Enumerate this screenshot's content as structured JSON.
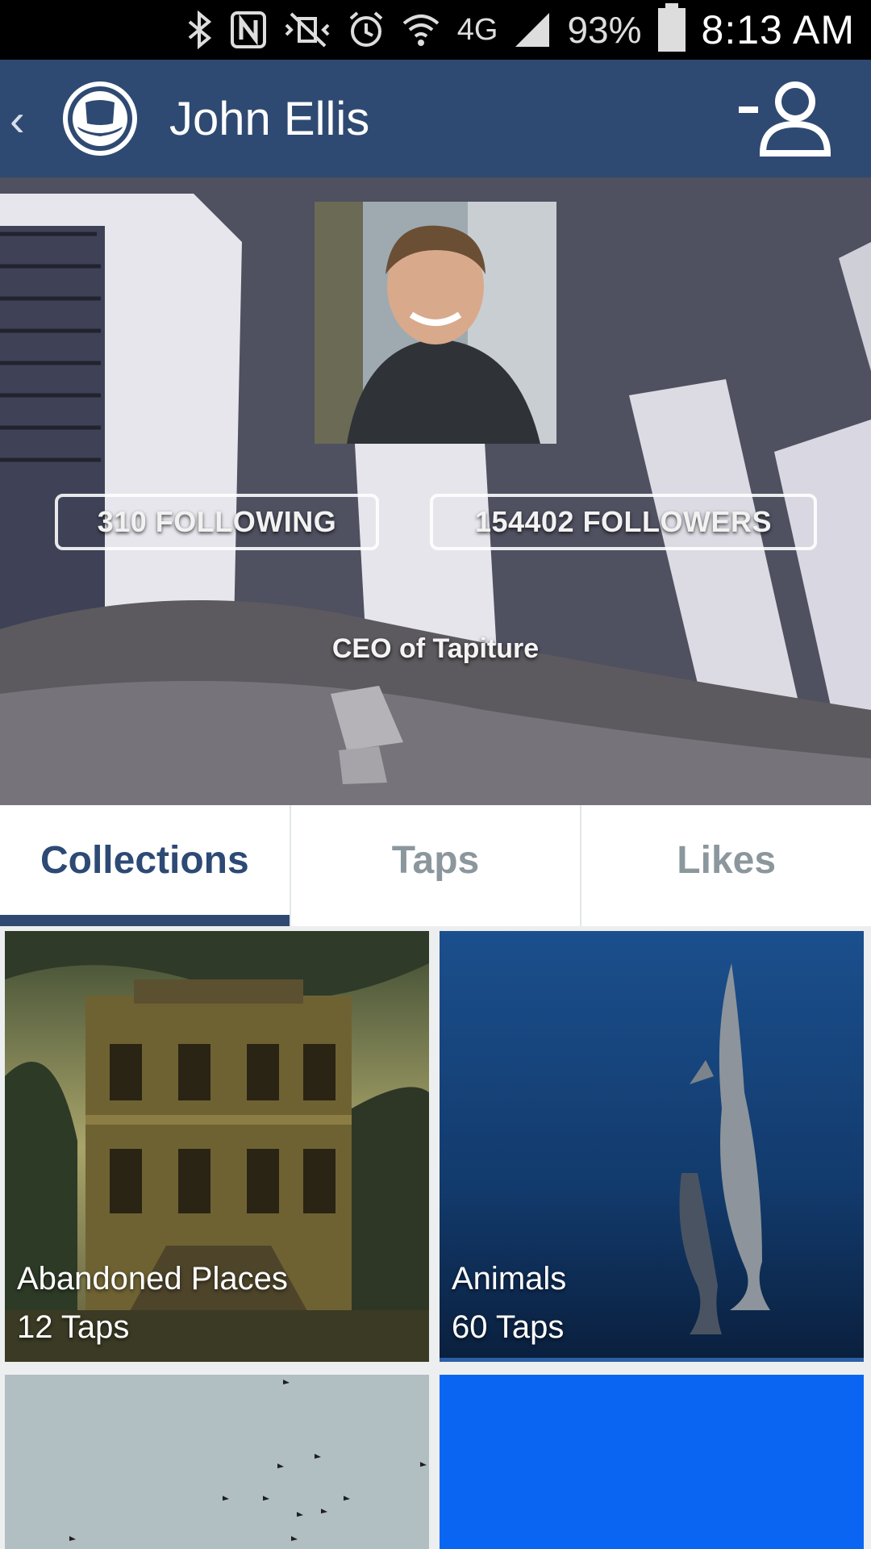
{
  "status_bar": {
    "time": "8:13 AM",
    "battery_percent": "93%",
    "network": "4G",
    "icons": [
      "bluetooth-icon",
      "nfc-icon",
      "vibrate-icon",
      "alarm-icon",
      "wifi-icon",
      "signal-icon",
      "battery-icon"
    ]
  },
  "app_bar": {
    "title": "John Ellis",
    "back_icon": "chevron-left-icon",
    "logo_icon": "top-hat-icon",
    "action_icon": "unfollow-user-icon",
    "color": "#2f4a72"
  },
  "profile": {
    "following_label": "310 FOLLOWING",
    "followers_label": "154402 FOLLOWERS",
    "tagline": "CEO of Tapiture"
  },
  "tabs": [
    {
      "label": "Collections",
      "active": true
    },
    {
      "label": "Taps",
      "active": false
    },
    {
      "label": "Likes",
      "active": false
    }
  ],
  "collections": [
    {
      "title": "Abandoned Places",
      "count": "12 Taps"
    },
    {
      "title": "Animals",
      "count": "60 Taps"
    },
    {
      "title": "",
      "count": ""
    },
    {
      "title": "",
      "count": ""
    }
  ],
  "colors": {
    "accent": "#2f4a72",
    "active_tab_text": "#2d4a75",
    "inactive_tab_text": "#8b979d"
  }
}
